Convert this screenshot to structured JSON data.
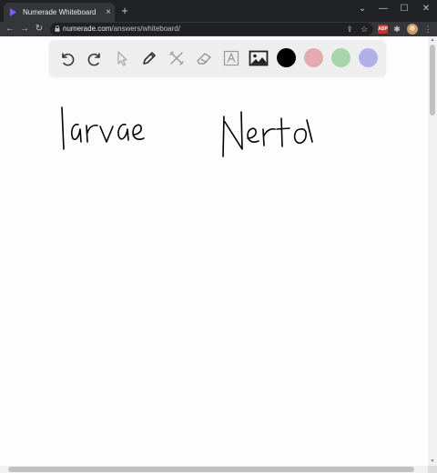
{
  "browser": {
    "tab_title": "Numerade Whiteboard",
    "tab_close": "×",
    "new_tab": "+",
    "url_host": "numerade.com",
    "url_path": "/answers/whiteboard/",
    "window_controls": {
      "dropdown": "⌄",
      "minimize": "—",
      "maximize": "☐",
      "close": "✕"
    },
    "nav": {
      "back": "←",
      "forward": "→",
      "reload": "↻"
    },
    "extensions": {
      "abp_badge": "ABP",
      "puzzle": "✱",
      "share": "⇪",
      "star": "☆",
      "menu": "⋮"
    }
  },
  "whiteboard": {
    "tools": [
      "undo-icon",
      "redo-icon",
      "pointer-icon",
      "pen-icon",
      "tools-icon",
      "eraser-icon",
      "text-icon",
      "image-icon"
    ],
    "colors": [
      {
        "name": "black",
        "hex": "#000000"
      },
      {
        "name": "pink",
        "hex": "#e6a9b1"
      },
      {
        "name": "green",
        "hex": "#a9d3a9"
      },
      {
        "name": "lavender",
        "hex": "#b1b1ea"
      }
    ],
    "handwritten_words": [
      "larvae",
      "Nerto"
    ]
  }
}
